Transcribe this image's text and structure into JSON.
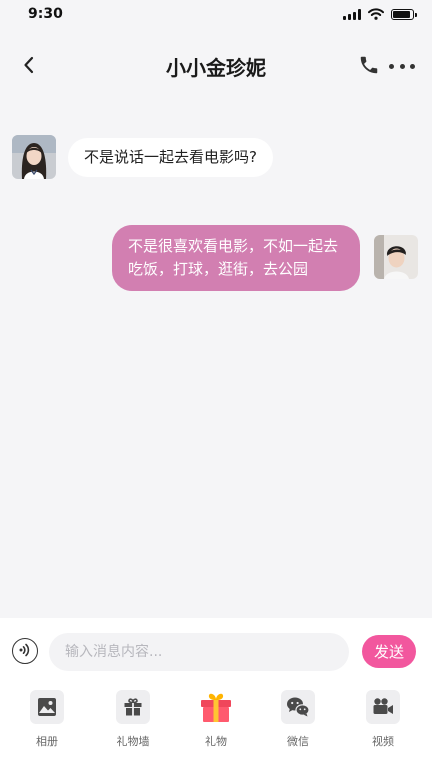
{
  "status_bar": {
    "time": "9:30",
    "battery_level": 0.9
  },
  "header": {
    "title": "小小金珍妮"
  },
  "messages": [
    {
      "side": "left",
      "text": "不是说话一起去看电影吗?"
    },
    {
      "side": "right",
      "text": "不是很喜欢看电影，不如一起去吃饭，打球，逛街，去公园"
    }
  ],
  "composer": {
    "placeholder": "输入消息内容...",
    "send_label": "发送"
  },
  "toolbar": [
    {
      "label": "相册",
      "icon": "photo-icon"
    },
    {
      "label": "礼物墙",
      "icon": "gift-wall-icon"
    },
    {
      "label": "礼物",
      "icon": "gift-icon"
    },
    {
      "label": "微信",
      "icon": "wechat-icon"
    },
    {
      "label": "视频",
      "icon": "video-camera-icon"
    }
  ],
  "colors": {
    "accent": "#f2579e",
    "outgoing_bubble": "#d27fb1",
    "background": "#f5f5f7"
  }
}
